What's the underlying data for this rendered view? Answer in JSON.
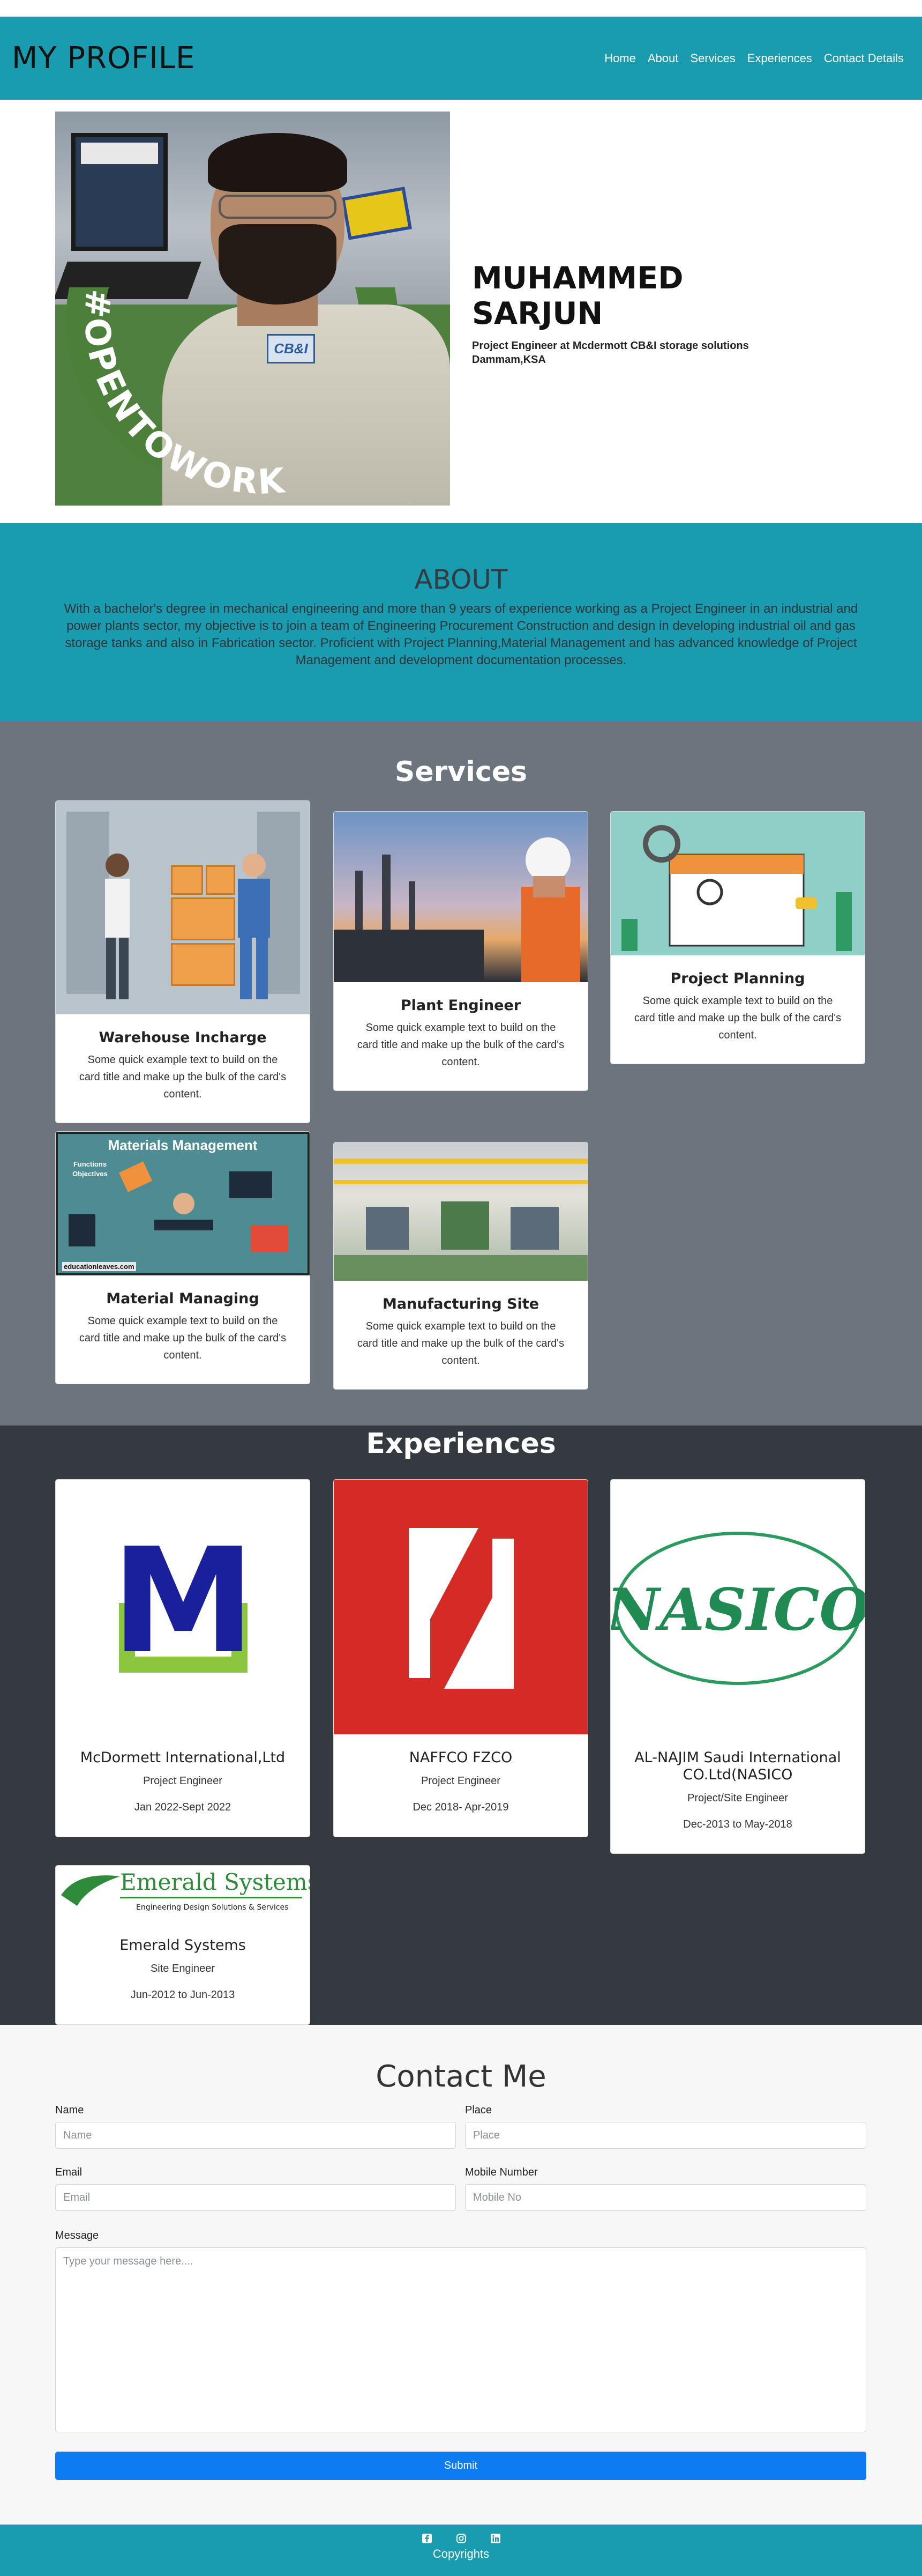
{
  "nav": {
    "brand": "MY PROFILE",
    "links": [
      "Home",
      "About",
      "Services",
      "Experiences",
      "Contact Details"
    ]
  },
  "hero": {
    "name": "MUHAMMED SARJUN",
    "role": "Project Engineer at Mcdermott CB&I storage solutions",
    "location": "Dammam,KSA",
    "photo_badge": "#OPENTOWORK",
    "photo_logo": "CB&I"
  },
  "about": {
    "title": "ABOUT",
    "text": "With a bachelor's degree in mechanical engineering and more than 9 years of experience working as a Project Engineer in an industrial and power plants sector, my objective is to join a team of Engineering Procurement Construction and design in developing industrial oil and gas storage tanks and also in Fabrication sector. Proficient with Project Planning,Material Management and has advanced knowledge of Project Management and development documentation processes."
  },
  "services": {
    "title": "Services",
    "items": [
      {
        "title": "Warehouse Incharge",
        "text": "Some quick example text to build on the card title and make up the bulk of the card's content.",
        "icon": "warehouse-illustration"
      },
      {
        "title": "Plant Engineer",
        "text": "Some quick example text to build on the card title and make up the bulk of the card's content.",
        "icon": "plant-engineer-photo"
      },
      {
        "title": "Project Planning",
        "text": "Some quick example text to build on the card title and make up the bulk of the card's content.",
        "icon": "project-planning-illustration"
      },
      {
        "title": "Material Managing",
        "text": "Some quick example text to build on the card title and make up the bulk of the card's content.",
        "icon": "materials-management-illustration",
        "image_heading": "Materials Management",
        "image_subtext": "Functions Objectives",
        "image_footer": "educationleaves.com"
      },
      {
        "title": "Manufacturing Site",
        "text": "Some quick example text to build on the card title and make up the bulk of the card's content.",
        "icon": "manufacturing-site-photo"
      }
    ]
  },
  "experiences": {
    "title": "Experiences",
    "items": [
      {
        "company": "McDormett International,Ltd",
        "role": "Project Engineer",
        "dates": "Jan 2022-Sept 2022",
        "logo": "mcdermott-logo",
        "logo_text": "M"
      },
      {
        "company": "NAFFCO FZCO",
        "role": "Project Engineer",
        "dates": "Dec 2018- Apr-2019",
        "logo": "naffco-logo",
        "logo_text": "N"
      },
      {
        "company": "AL-NAJIM Saudi International CO.Ltd(NASICO",
        "role": "Project/Site Engineer",
        "dates": "Dec-2013 to May-2018",
        "logo": "nasico-logo",
        "logo_text": "NASICO"
      },
      {
        "company": "Emerald Systems",
        "role": "Site Engineer",
        "dates": "Jun-2012 to Jun-2013",
        "logo": "emerald-systems-logo",
        "logo_text": "Emerald Systems",
        "logo_subtext": "Engineering Design Solutions & Services"
      }
    ]
  },
  "contact": {
    "title": "Contact Me",
    "name_label": "Name",
    "name_placeholder": "Name",
    "place_label": "Place",
    "place_placeholder": "Place",
    "email_label": "Email",
    "email_placeholder": "Email",
    "mobile_label": "Mobile Number",
    "mobile_placeholder": "Mobile No",
    "message_label": "Message",
    "message_placeholder": "Type your message here....",
    "submit_label": "Submit"
  },
  "footer": {
    "icons": [
      "facebook-icon",
      "instagram-icon",
      "linkedin-icon"
    ],
    "copyright": "Copyrights"
  },
  "colors": {
    "teal": "#1a9cb0",
    "services_bg": "#6c757d",
    "experiences_bg": "#343a40",
    "contact_bg": "#f7f7f8",
    "submit_blue": "#0d7cf2"
  }
}
